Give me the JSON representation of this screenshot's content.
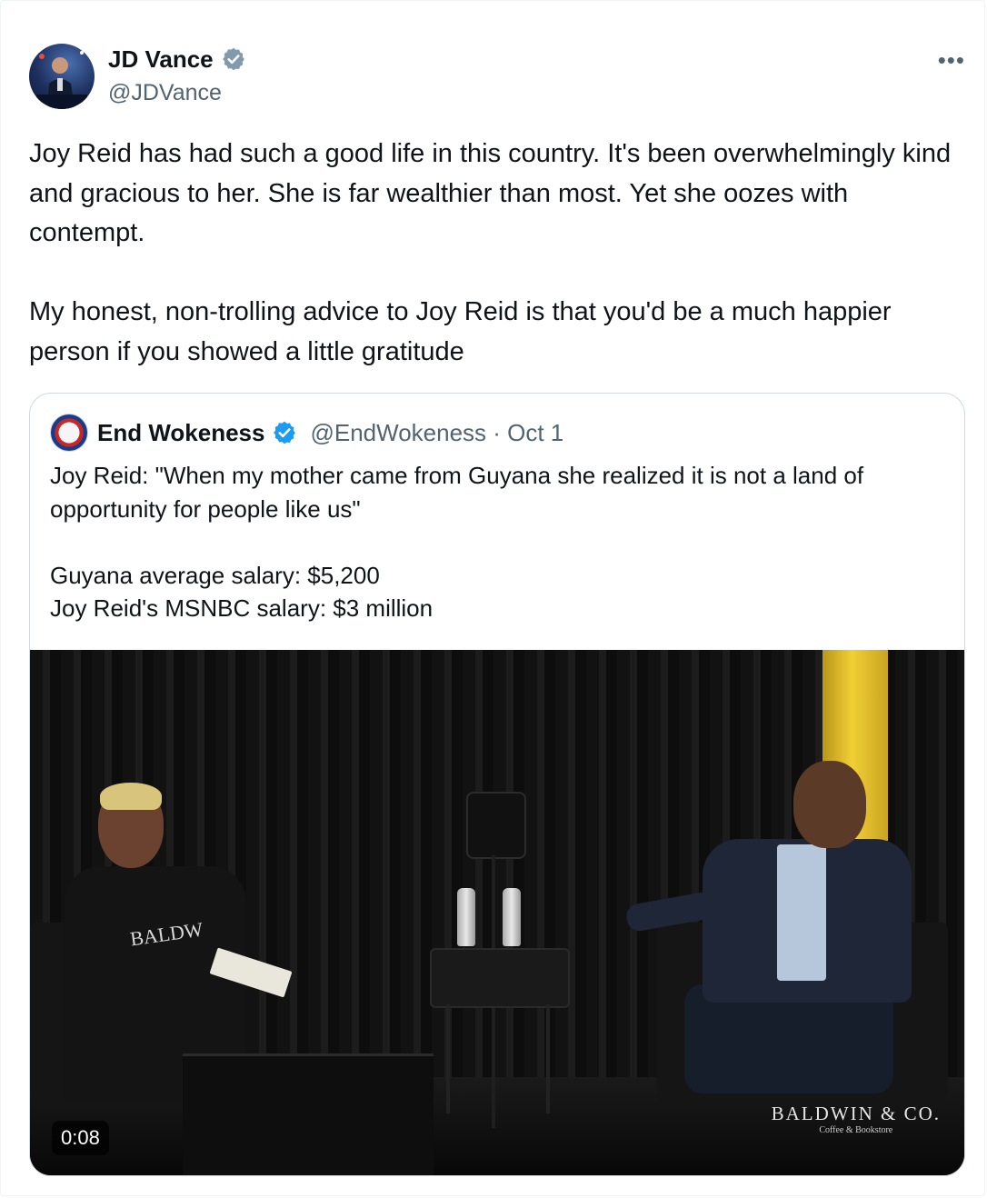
{
  "tweet": {
    "author": {
      "display_name": "JD Vance",
      "handle": "@JDVance",
      "verified": true,
      "avatar_icon": "profile-photo"
    },
    "more_label": "•••",
    "text": {
      "paragraph_1": "Joy Reid has had such a good life in this country. It's been overwhelmingly kind and gracious to her. She is far wealthier than most. Yet she oozes with contempt.",
      "paragraph_2": "My honest, non-trolling advice to Joy Reid is that you'd be a much happier person if you showed a little gratitude"
    }
  },
  "quoted_tweet": {
    "author": {
      "display_name": "End Wokeness",
      "handle_date": "@EndWokeness · Oct 1",
      "verified": true
    },
    "text": {
      "line_1": "Joy Reid: \"When my mother came from Guyana she realized it is not a land of opportunity for people like us\"",
      "line_2": "Guyana average salary: $5,200",
      "line_3": "Joy Reid's MSNBC salary: $3 million"
    },
    "video": {
      "duration": "0:08",
      "shirt_logo": "BALDW",
      "brand_name": "BALDWIN & CO.",
      "brand_sub": "Coffee & Bookstore"
    }
  },
  "colors": {
    "text_primary": "#0f1419",
    "text_secondary": "#536471",
    "verified_blue": "#1d9bf0",
    "border": "#cfd9de"
  }
}
